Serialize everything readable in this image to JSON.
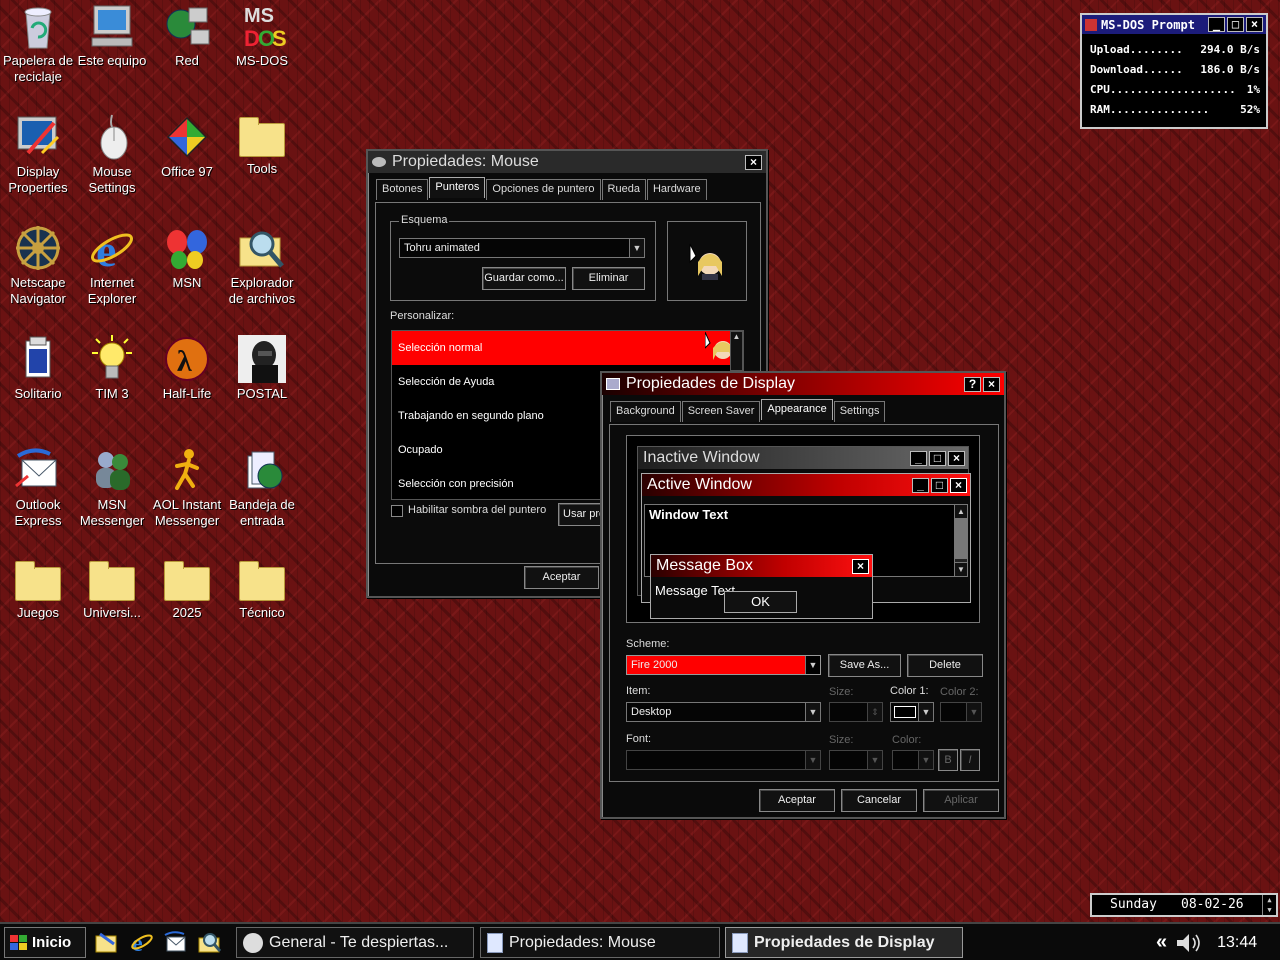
{
  "desktop_icons": [
    {
      "label": "Papelera de reciclaje",
      "icon": "recycle-bin-icon"
    },
    {
      "label": "Este equipo",
      "icon": "computer-icon"
    },
    {
      "label": "Red",
      "icon": "network-icon"
    },
    {
      "label": "MS-DOS",
      "icon": "msdos-icon"
    },
    {
      "label": "Display Properties",
      "icon": "display-properties-icon"
    },
    {
      "label": "Mouse Settings",
      "icon": "mouse-icon"
    },
    {
      "label": "Office 97",
      "icon": "office-icon"
    },
    {
      "label": "Tools",
      "icon": "tools-folder-icon"
    },
    {
      "label": "Netscape Navigator",
      "icon": "netscape-icon"
    },
    {
      "label": "Internet Explorer",
      "icon": "internet-explorer-icon"
    },
    {
      "label": "MSN",
      "icon": "msn-butterfly-icon"
    },
    {
      "label": "Explorador de archivos",
      "icon": "file-explorer-icon"
    },
    {
      "label": "Solitario",
      "icon": "solitaire-icon"
    },
    {
      "label": "TIM 3",
      "icon": "lightbulb-icon"
    },
    {
      "label": "Half-Life",
      "icon": "half-life-icon"
    },
    {
      "label": "POSTAL",
      "icon": "postal-icon"
    },
    {
      "label": "Outlook Express",
      "icon": "outlook-express-icon"
    },
    {
      "label": "MSN Messenger",
      "icon": "msn-messenger-icon"
    },
    {
      "label": "AOL Instant Messenger",
      "icon": "aim-icon"
    },
    {
      "label": "Bandeja de entrada",
      "icon": "inbox-icon"
    },
    {
      "label": "Juegos",
      "icon": "folder-icon"
    },
    {
      "label": "Universi...",
      "icon": "folder-icon"
    },
    {
      "label": "2025",
      "icon": "folder-icon"
    },
    {
      "label": "Técnico",
      "icon": "folder-icon"
    }
  ],
  "dos_widget": {
    "title": "MS-DOS Prompt",
    "rows": [
      {
        "label": "Upload........",
        "value": "294.0 B/s"
      },
      {
        "label": "Download......",
        "value": "186.0 B/s"
      },
      {
        "label": "CPU...................",
        "value": "1%"
      },
      {
        "label": "RAM...............",
        "value": "52%"
      }
    ]
  },
  "mouse_window": {
    "title": "Propiedades: Mouse",
    "tabs": [
      "Botones",
      "Punteros",
      "Opciones de puntero",
      "Rueda",
      "Hardware"
    ],
    "active_tab": "Punteros",
    "scheme_label": "Esquema",
    "scheme_value": "Tohru animated",
    "save_as": "Guardar como...",
    "delete": "Eliminar",
    "customize_label": "Personalizar:",
    "pointers": [
      "Selección normal",
      "Selección de Ayuda",
      "Trabajando en segundo plano",
      "Ocupado",
      "Selección con precisión"
    ],
    "shadow_label": "Habilitar sombra del puntero",
    "use_default": "Usar pre",
    "ok": "Aceptar"
  },
  "display_window": {
    "title": "Propiedades de Display",
    "help": "?",
    "tabs": [
      "Background",
      "Screen Saver",
      "Appearance",
      "Settings"
    ],
    "active_tab": "Appearance",
    "preview": {
      "inactive_title": "Inactive Window",
      "active_title": "Active Window",
      "window_text": "Window Text",
      "message_box_title": "Message Box",
      "message_text": "Message Text",
      "ok": "OK"
    },
    "scheme_label": "Scheme:",
    "scheme_value": "Fire 2000",
    "save_as": "Save As...",
    "delete": "Delete",
    "item_label": "Item:",
    "item_value": "Desktop",
    "size_label": "Size:",
    "color1_label": "Color 1:",
    "color2_label": "Color 2:",
    "font_label": "Font:",
    "font_size_label": "Size:",
    "font_color_label": "Color:",
    "bold": "B",
    "italic": "I",
    "ok": "Aceptar",
    "cancel": "Cancelar",
    "apply": "Aplicar"
  },
  "clock_widget": {
    "day": "Sunday",
    "date": "08-02-26"
  },
  "taskbar": {
    "start": "Inicio",
    "tasks": [
      "General - Te despiertas...",
      "Propiedades: Mouse",
      "Propiedades de Display"
    ],
    "tray_chevron": "«",
    "time": "13:44"
  },
  "colors": {
    "accent": "#ff0000",
    "window_bg": "#0a0a0a",
    "desktop": "#6a1212"
  }
}
